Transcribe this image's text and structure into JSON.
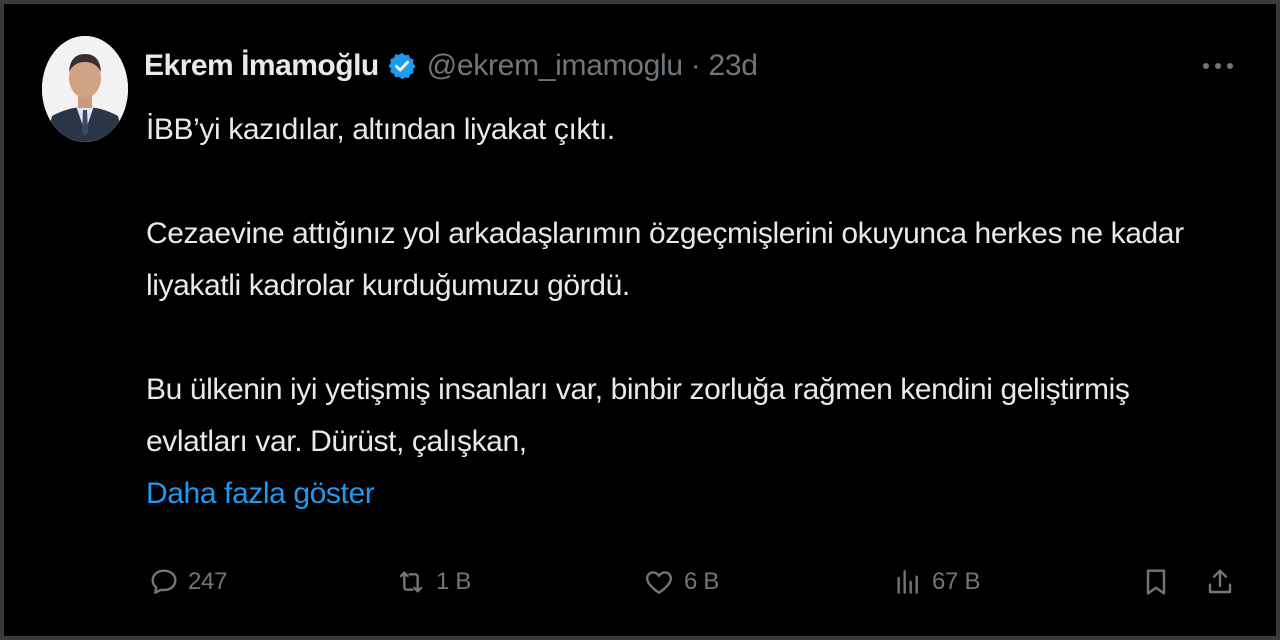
{
  "tweet": {
    "author_name": "Ekrem İmamoğlu",
    "handle": "@ekrem_imamoglu",
    "separator": "·",
    "time": "23d",
    "paragraphs": [
      "İBB’yi kazıdılar, altından liyakat çıktı.",
      "Cezaevine attığınız yol arkadaşlarımın özgeçmişlerini okuyunca herkes ne kadar liyakatli kadrolar kurduğumuzu gördü.",
      "Bu ülkenin iyi yetişmiş insanları var, binbir zorluğa rağmen kendini geliştirmiş evlatları var. Dürüst, çalışkan,"
    ],
    "show_more": "Daha fazla göster"
  },
  "actions": {
    "replies": "247",
    "reposts": "1 B",
    "likes": "6 B",
    "views": "67 B"
  },
  "icons": {
    "reply": "comment-icon",
    "repost": "repost-icon",
    "like": "heart-icon",
    "views": "bar-chart-icon",
    "bookmark": "bookmark-icon",
    "share": "share-icon",
    "more": "more-dots-icon",
    "verified": "verified-badge-icon"
  },
  "colors": {
    "background": "#000000",
    "text": "#e7e9ea",
    "muted": "#71767b",
    "link": "#1d9bf0",
    "verified": "#1d9bf0"
  }
}
